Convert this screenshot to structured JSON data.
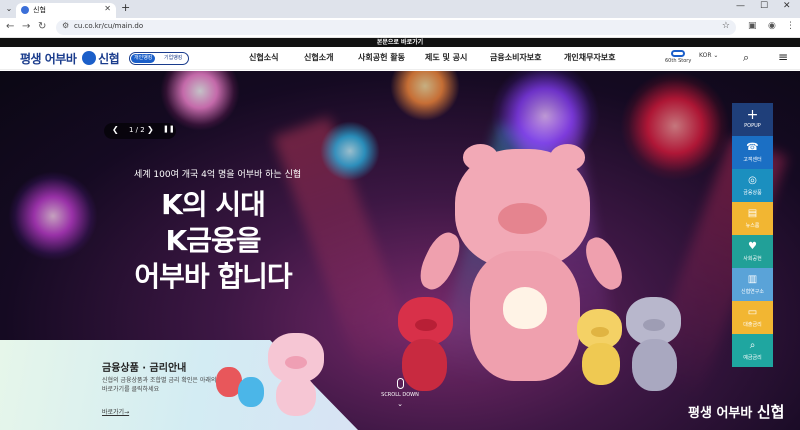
{
  "browser": {
    "tab_title": "신협",
    "url": "cu.co.kr/cu/main.do"
  },
  "skip_link": "본문으로 바로가기",
  "header": {
    "logo_text_1": "평생 어부바",
    "logo_text_2": "신협",
    "member_tabs": [
      "개인뱅킹",
      "기업뱅킹"
    ],
    "menu": [
      "신협소식",
      "신협소개",
      "사회공헌 활동",
      "제도 및 공시",
      "금융소비자보호",
      "개인채무자보호"
    ],
    "story_label": "60th Story",
    "language": "KOR"
  },
  "hero": {
    "slide_counter": "1 / 2",
    "subtitle": "세계 100여 개국 4억 명을 어부바 하는 신협",
    "headline_lines": [
      "K의 시대",
      "K금융을",
      "어부바 합니다"
    ],
    "scroll_label": "SCROLL DOWN",
    "corner_logo_text": "평생 어부바",
    "corner_logo_brand": "신협"
  },
  "card": {
    "title": "금융상품 · 금리안내",
    "description": "신협의 금융상품과 조합별 금리 확인은 아래의 바로가기를 클릭하세요",
    "link": "바로가기→"
  },
  "quick_menu": [
    {
      "label": "POPUP",
      "icon": "plus-icon",
      "color": "#1f3f7a"
    },
    {
      "label": "고객센터",
      "icon": "phone-icon",
      "color": "#1b6fc4"
    },
    {
      "label": "금융상품",
      "icon": "coins-icon",
      "color": "#1b8fbf"
    },
    {
      "label": "뉴스룸",
      "icon": "document-icon",
      "color": "#f2b632"
    },
    {
      "label": "사회공헌",
      "icon": "hand-heart-icon",
      "color": "#21a098"
    },
    {
      "label": "신협연구소",
      "icon": "building-icon",
      "color": "#5aa3d8"
    },
    {
      "label": "대출금리",
      "icon": "monitor-icon",
      "color": "#f2b632"
    },
    {
      "label": "예금금리",
      "icon": "magnifier-icon",
      "color": "#1fa6a0"
    }
  ]
}
